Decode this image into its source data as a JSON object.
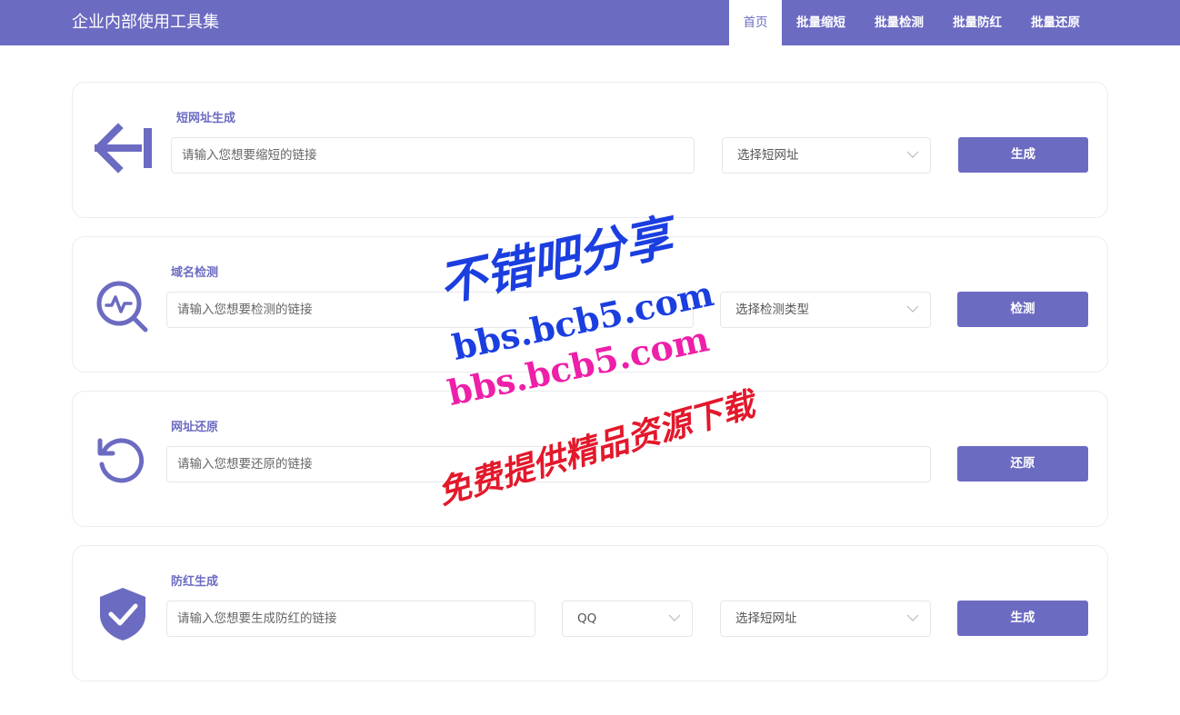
{
  "header": {
    "brand": "企业内部使用工具集",
    "nav": [
      {
        "label": "首页",
        "active": true
      },
      {
        "label": "批量缩短",
        "active": false
      },
      {
        "label": "批量检测",
        "active": false
      },
      {
        "label": "批量防红",
        "active": false
      },
      {
        "label": "批量还原",
        "active": false
      }
    ]
  },
  "cards": {
    "shorten": {
      "title": "短网址生成",
      "icon": "arrow-left-bar-icon",
      "input_placeholder": "请输入您想要缩短的链接",
      "select_value": "选择短网址",
      "button": "生成"
    },
    "detect": {
      "title": "域名检测",
      "icon": "pulse-search-icon",
      "input_placeholder": "请输入您想要检测的链接",
      "select_value": "选择检测类型",
      "button": "检测"
    },
    "restore": {
      "title": "网址还原",
      "icon": "restore-rotate-icon",
      "input_placeholder": "请输入您想要还原的链接",
      "button": "还原"
    },
    "antired": {
      "title": "防红生成",
      "icon": "shield-check-icon",
      "input_placeholder": "请输入您想要生成防红的链接",
      "platform_value": "QQ",
      "select_value": "选择短网址",
      "button": "生成"
    }
  },
  "watermark": {
    "line1": "不错吧分享",
    "line2": "bbs.bcb5.com",
    "line3": "bbs.bcb5.com",
    "line4": "免费提供精品资源下载"
  },
  "colors": {
    "accent": "#6c6bc2",
    "border": "#ececf2"
  }
}
